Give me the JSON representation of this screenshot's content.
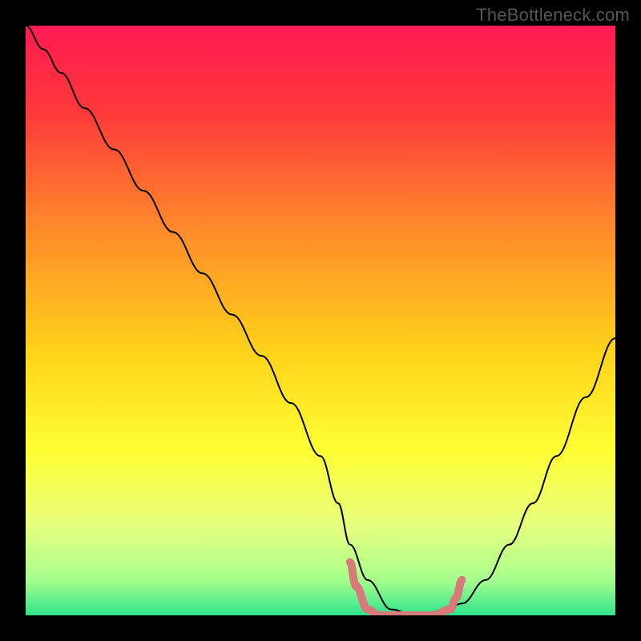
{
  "watermark": "TheBottleneck.com",
  "chart_data": {
    "type": "line",
    "title": "",
    "xlabel": "",
    "ylabel": "",
    "xlim": [
      0,
      100
    ],
    "ylim": [
      0,
      100
    ],
    "grid": false,
    "legend": false,
    "background": {
      "type": "vertical_gradient",
      "stops": [
        {
          "pos": 0.0,
          "color": "#ff1a52"
        },
        {
          "pos": 0.15,
          "color": "#ff3a3a"
        },
        {
          "pos": 0.35,
          "color": "#ff8c2a"
        },
        {
          "pos": 0.55,
          "color": "#ffd21a"
        },
        {
          "pos": 0.72,
          "color": "#ffff33"
        },
        {
          "pos": 0.85,
          "color": "#e6ff80"
        },
        {
          "pos": 0.94,
          "color": "#a6ff8c"
        },
        {
          "pos": 1.0,
          "color": "#2fe28c"
        }
      ]
    },
    "series": [
      {
        "name": "bottleneck_curve",
        "stroke": "#000000",
        "stroke_width": 2,
        "x": [
          0,
          3,
          6,
          10,
          15,
          20,
          25,
          30,
          35,
          40,
          45,
          50,
          53,
          55,
          58,
          62,
          66,
          70,
          74,
          78,
          82,
          86,
          90,
          95,
          100
        ],
        "y": [
          100,
          96,
          92,
          86,
          79,
          72,
          65,
          58,
          51,
          44,
          36,
          27,
          19,
          12,
          6,
          1,
          0,
          0,
          2,
          6,
          12,
          19,
          27,
          37,
          47
        ]
      },
      {
        "name": "optimal_zone",
        "stroke": "#d97a7a",
        "stroke_width": 10,
        "linecap": "round",
        "x": [
          55,
          56,
          58,
          60,
          63,
          66,
          69,
          72,
          73,
          74
        ],
        "y": [
          9,
          5,
          1,
          0,
          0,
          0,
          0,
          1,
          3,
          6
        ]
      }
    ]
  }
}
